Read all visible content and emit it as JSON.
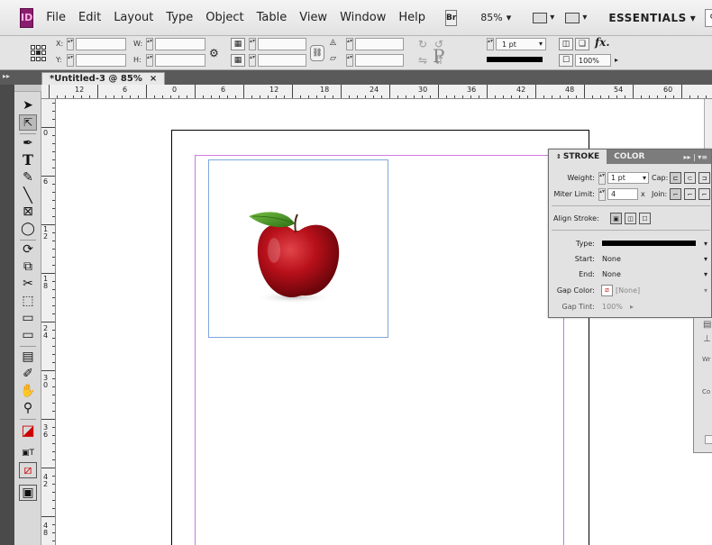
{
  "app": {
    "logo": "ID",
    "menus": [
      "File",
      "Edit",
      "Layout",
      "Type",
      "Object",
      "Table",
      "View",
      "Window",
      "Help"
    ],
    "bridge_label": "Br",
    "zoom": "85%",
    "workspace": "ESSENTIALS"
  },
  "control_panel": {
    "x_label": "X:",
    "y_label": "Y:",
    "w_label": "W:",
    "h_label": "H:",
    "stroke_weight": "1 pt",
    "opacity": "100%",
    "p_glyph": "P",
    "fx_label": "fx."
  },
  "document": {
    "tab_title": "*Untitled-3 @ 85%",
    "tab_close": "×"
  },
  "ruler": {
    "top_numbers": [
      "12",
      "6",
      "0",
      "6",
      "12",
      "18",
      "24",
      "30",
      "36",
      "42",
      "48",
      "54",
      "60"
    ],
    "left_numbers": [
      "0",
      "6",
      "1 2",
      "1 8",
      "2 4",
      "3 0",
      "3 6",
      "4 2",
      "4 8"
    ]
  },
  "stroke_panel": {
    "tab_stroke": "STROKE",
    "tab_color": "COLOR",
    "menu_glyph": "▸▸ | ▾≡",
    "weight_label": "Weight:",
    "weight_value": "1 pt",
    "cap_label": "Cap:",
    "miter_label": "Miter Limit:",
    "miter_value": "4",
    "x_label": "x",
    "join_label": "Join:",
    "align_label": "Align Stroke:",
    "type_label": "Type:",
    "start_label": "Start:",
    "start_value": "None",
    "end_label": "End:",
    "end_value": "None",
    "gap_color_label": "Gap Color:",
    "gap_color_value": "[None]",
    "gap_tint_label": "Gap Tint:",
    "gap_tint_value": "100%"
  },
  "right_panel": {
    "wrap_text": "Wr",
    "co_text": "Co"
  },
  "colors": {
    "margin_guide": "#c47ae0",
    "frame_edge": "#7fa7dd",
    "logo_bg": "#8a1c6e",
    "apple_red": "#b8101a",
    "leaf_green": "#4d9a2a"
  },
  "icons": {
    "selection": "black-arrow-icon",
    "direct_selection": "white-arrow-icon",
    "pen": "pen-icon",
    "type": "type-icon",
    "pencil": "pencil-icon",
    "line": "line-icon",
    "rect_frame": "rectangle-frame-icon",
    "ellipse": "ellipse-icon",
    "scissors": "scissors-icon",
    "gradient": "gradient-icon",
    "note": "note-icon",
    "eyedropper": "eyedropper-icon",
    "hand": "hand-icon",
    "zoom": "zoom-icon"
  }
}
